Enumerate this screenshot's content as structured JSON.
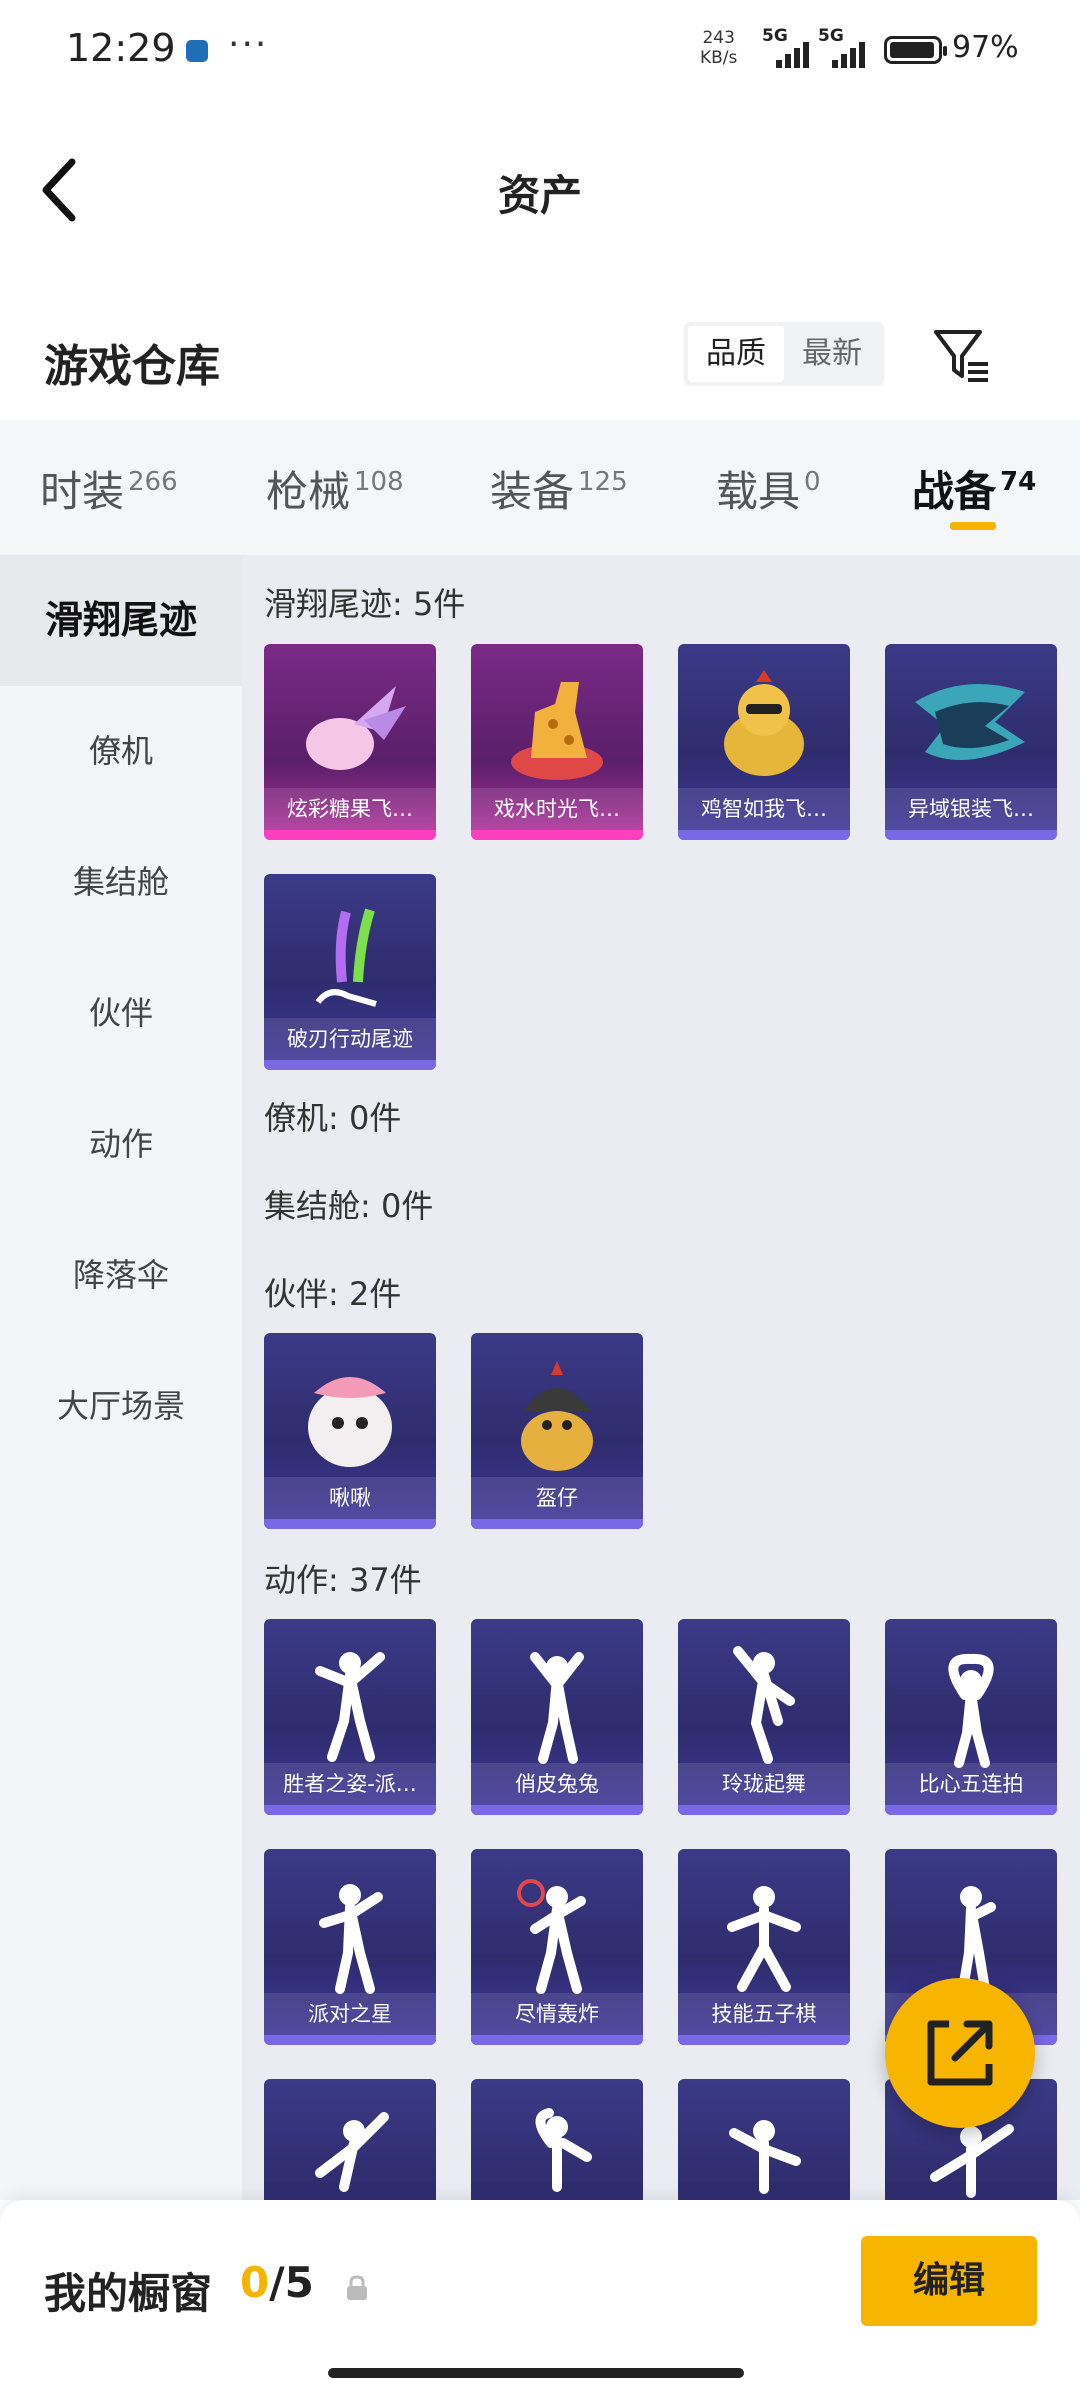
{
  "status_bar": {
    "time": "12:29",
    "speed_top": "243",
    "speed_bottom": "KB/s",
    "signal1": "5G",
    "signal2": "5G",
    "battery": "97%",
    "icons": [
      "app-notification-icon",
      "more-dots-icon",
      "signal-icon",
      "battery-icon"
    ]
  },
  "header": {
    "title": "资产",
    "back_icon": "chevron-left-icon"
  },
  "warehouse": {
    "title": "游戏仓库",
    "sort_options": [
      "品质",
      "最新"
    ],
    "sort_selected": "品质",
    "filter_icon": "filter-funnel-icon"
  },
  "tabs": [
    {
      "label": "时装",
      "count": "266"
    },
    {
      "label": "枪械",
      "count": "108"
    },
    {
      "label": "装备",
      "count": "125"
    },
    {
      "label": "载具",
      "count": "0"
    },
    {
      "label": "战备",
      "count": "74"
    }
  ],
  "active_tab": "战备",
  "sidebar": [
    "滑翔尾迹",
    "僚机",
    "集结舱",
    "伙伴",
    "动作",
    "降落伞",
    "大厅场景"
  ],
  "sidebar_active": "滑翔尾迹",
  "sections": {
    "glide_trail": {
      "title": "滑翔尾迹: 5件",
      "items": [
        "炫彩糖果飞…",
        "戏水时光飞…",
        "鸡智如我飞…",
        "异域银装飞…",
        "破刃行动尾迹"
      ]
    },
    "wingman": {
      "title": "僚机: 0件"
    },
    "assembly_pod": {
      "title": "集结舱: 0件"
    },
    "companion": {
      "title": "伙伴: 2件",
      "items": [
        "啾啾",
        "盔仔"
      ]
    },
    "emote": {
      "title": "动作: 37件",
      "items": [
        "胜者之姿-派…",
        "俏皮兔兔",
        "玲珑起舞",
        "比心五连拍",
        "派对之星",
        "尽情轰炸",
        "技能五子棋",
        "",
        "",
        "",
        "",
        ""
      ]
    }
  },
  "fab_icon": "share-export-icon",
  "bottom_bar": {
    "title": "我的橱窗",
    "current": "0",
    "total": "/5",
    "lock_icon": "lock-icon",
    "edit_label": "编辑"
  },
  "colors": {
    "accent": "#f6b400",
    "card_purple": "#3b3a87",
    "card_pink": "#b6349e"
  }
}
